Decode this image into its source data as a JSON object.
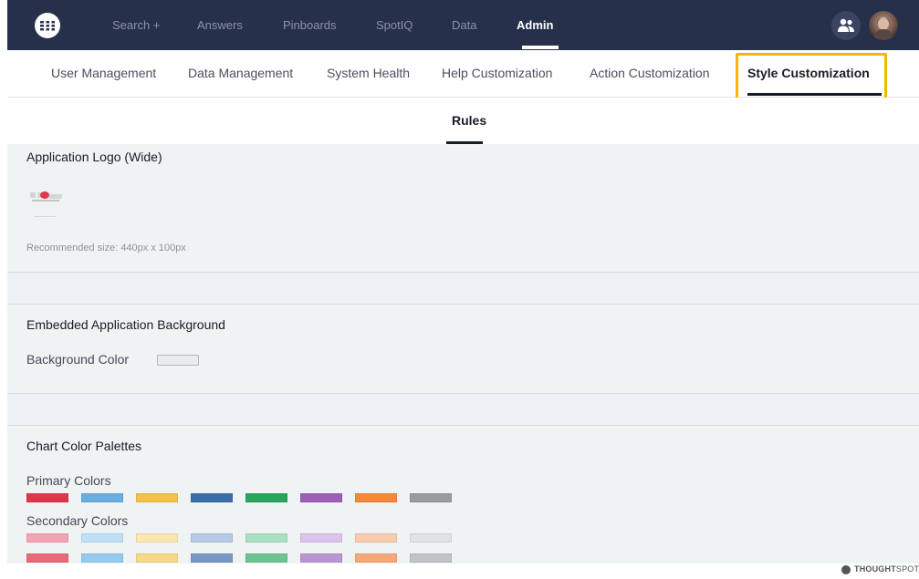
{
  "topnav": {
    "items": [
      {
        "label": "Search +",
        "active": false
      },
      {
        "label": "Answers",
        "active": false
      },
      {
        "label": "Pinboards",
        "active": false
      },
      {
        "label": "SpotIQ",
        "active": false
      },
      {
        "label": "Data",
        "active": false
      },
      {
        "label": "Admin",
        "active": true
      }
    ],
    "icons": {
      "logo": "thoughtspot-logo-icon",
      "people": "people-icon",
      "avatar": "user-avatar"
    }
  },
  "subnav": {
    "items": [
      {
        "label": "User Management",
        "active": false
      },
      {
        "label": "Data Management",
        "active": false
      },
      {
        "label": "System Health",
        "active": false
      },
      {
        "label": "Help Customization",
        "active": false
      },
      {
        "label": "Action Customization",
        "active": false
      },
      {
        "label": "Style Customization",
        "active": true
      }
    ]
  },
  "tabs": {
    "rules": "Rules"
  },
  "logo_section": {
    "title": "Application Logo (Wide)",
    "hint": "Recommended size: 440px x 100px"
  },
  "background_section": {
    "title": "Embedded Application Background",
    "color_label": "Background Color",
    "color_value": "#e9ecef"
  },
  "palette_section": {
    "title": "Chart Color Palettes",
    "primary_label": "Primary Colors",
    "secondary_label": "Secondary Colors",
    "primary": [
      "#e0364b",
      "#6aaee0",
      "#f4c04a",
      "#3a6ea8",
      "#28a45c",
      "#9b5fb8",
      "#f5893a",
      "#999b9e"
    ],
    "secondary_light": [
      "#f4a4b0",
      "#bfe0f7",
      "#fbe7b0",
      "#b5c9e8",
      "#a9dfc2",
      "#dcc3ec",
      "#f9cbb0",
      "#e0e2e4"
    ],
    "secondary_mid": [
      "#e86a78",
      "#94cbef",
      "#f8d989",
      "#7897c4",
      "#6cc394",
      "#b995d4",
      "#f7a878",
      "#c1c3c6"
    ]
  },
  "footer": {
    "brand_bold": "THOUGHT",
    "brand_light": "SPOT"
  }
}
